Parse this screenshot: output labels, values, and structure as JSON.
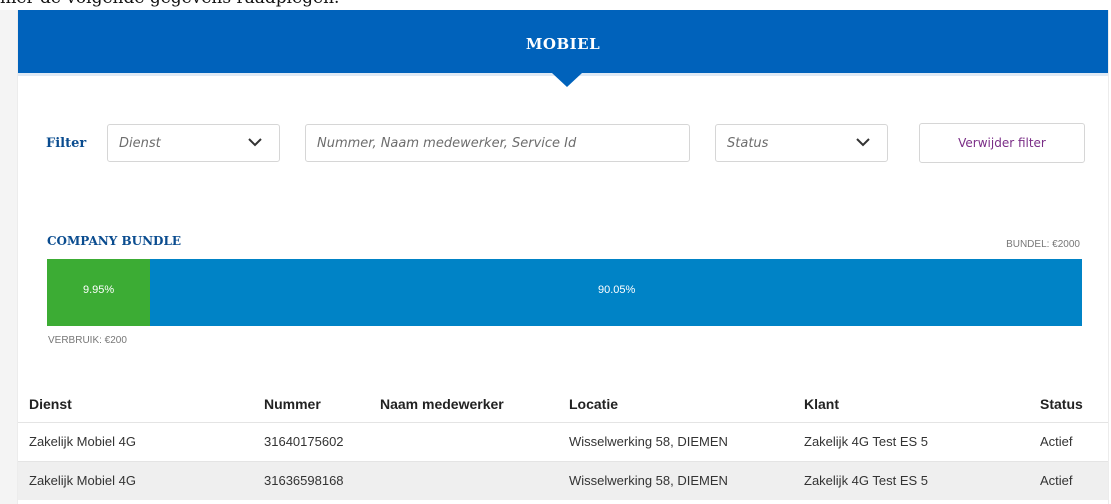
{
  "page": {
    "intro_text": "hier de volgende gegevens raadplegen."
  },
  "header": {
    "title": "MOBIEL"
  },
  "filter": {
    "label": "Filter",
    "dienst_placeholder": "Dienst",
    "search_placeholder": "Nummer, Naam medewerker, Service Id",
    "status_placeholder": "Status",
    "clear_button": "Verwijder filter"
  },
  "bundle": {
    "title": "COMPANY BUNDLE",
    "total_label": "BUNDEL: €2000",
    "usage_label": "VERBRUIK: €200",
    "used_percent_label": "9.95%",
    "remaining_percent_label": "90.05%",
    "used_fraction": 0.0995,
    "used_color": "#3cac34",
    "remaining_color": "#0083c6"
  },
  "table": {
    "headers": [
      "Dienst",
      "Nummer",
      "Naam medewerker",
      "Locatie",
      "Klant",
      "Status"
    ],
    "rows": [
      [
        "Zakelijk Mobiel 4G",
        "31640175602",
        "",
        "Wisselwerking 58, DIEMEN",
        "Zakelijk 4G Test ES 5",
        "Actief"
      ],
      [
        "Zakelijk Mobiel 4G",
        "31636598168",
        "",
        "Wisselwerking 58, DIEMEN",
        "Zakelijk 4G Test ES 5",
        "Actief"
      ]
    ]
  },
  "icons": {
    "dropdown": "chevron-down-icon"
  },
  "colors": {
    "header": "#0062bb",
    "accent_text": "#0a4c8f",
    "button_text": "#7a2d86"
  }
}
